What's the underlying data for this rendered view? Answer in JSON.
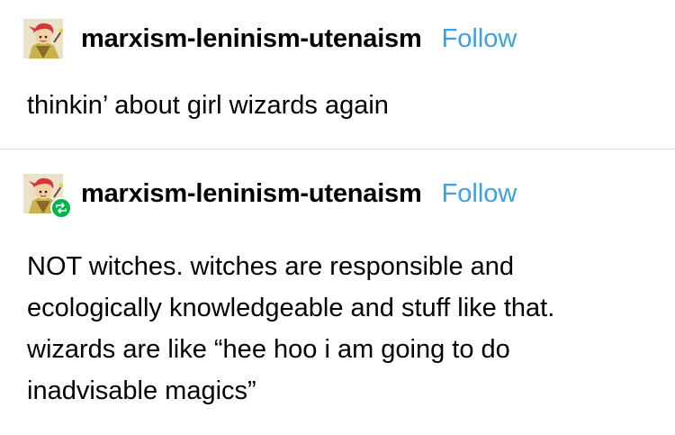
{
  "posts": [
    {
      "username": "marxism-leninism-utenaism",
      "follow_label": "Follow",
      "avatar_icon": "anime-character-avatar",
      "body": "thinkin’ about girl wizards again"
    },
    {
      "username": "marxism-leninism-utenaism",
      "follow_label": "Follow",
      "avatar_icon": "anime-character-avatar",
      "badge_icon": "reblog-icon",
      "badge_color": "#00b34a",
      "body": "NOT witches. witches are responsible and ecologically knowledgeable and stuff like that. wizards are like “hee hoo i am going to do inadvisable magics”"
    }
  ],
  "colors": {
    "follow": "#3aa0e8",
    "divider": "#d6d6d6",
    "text": "#000000"
  }
}
